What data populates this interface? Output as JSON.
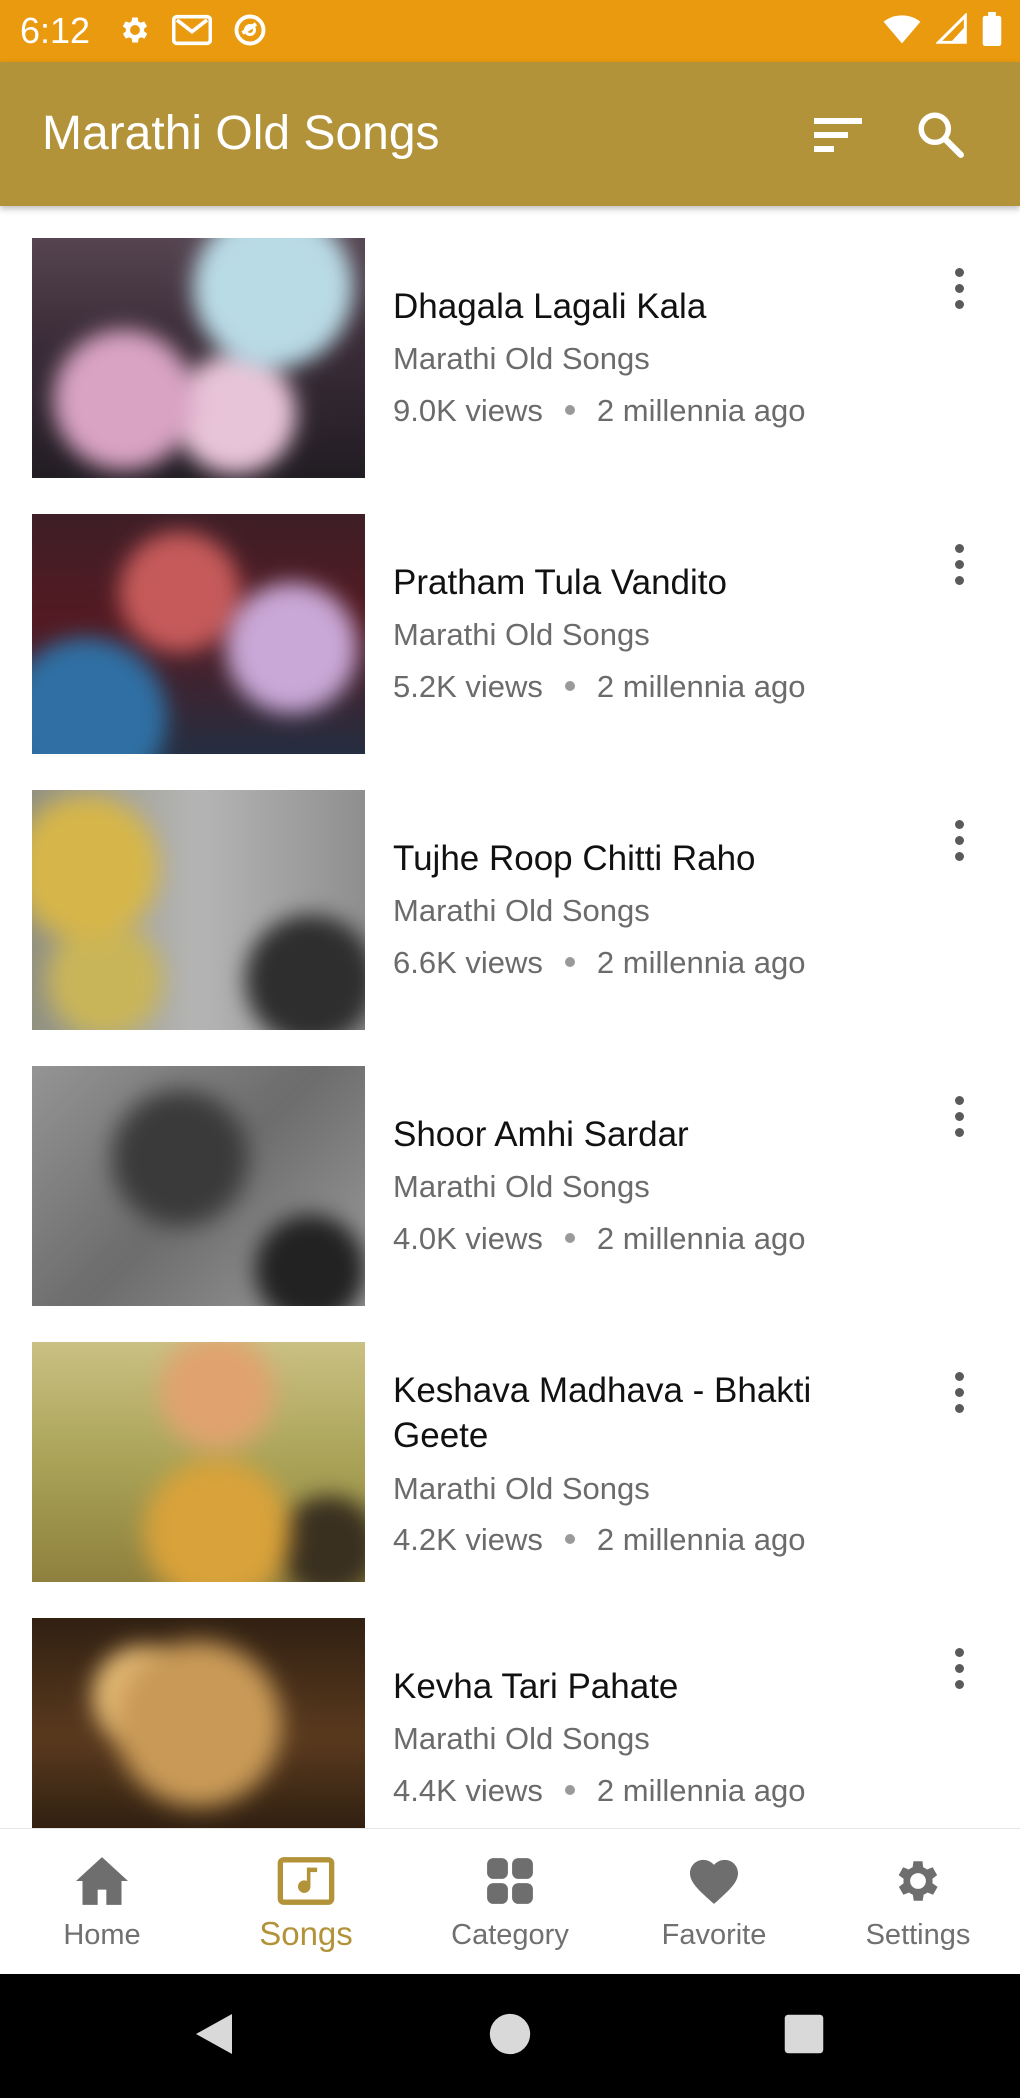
{
  "status_bar": {
    "time": "6:12",
    "left_icons": [
      "settings-icon",
      "gmail-icon",
      "data-saver-icon"
    ],
    "right_icons": [
      "wifi-icon",
      "signal-icon",
      "battery-icon"
    ],
    "background": "#EA9A0E"
  },
  "app_bar": {
    "title": "Marathi Old Songs",
    "actions": [
      "sort-icon",
      "search-icon"
    ],
    "background": "#B3933A"
  },
  "songs": [
    {
      "title": "Dhagala Lagali Kala",
      "channel": "Marathi Old Songs",
      "views": "9.0K views",
      "age": "2 millennia ago"
    },
    {
      "title": "Pratham Tula Vandito",
      "channel": "Marathi Old Songs",
      "views": "5.2K views",
      "age": "2 millennia ago"
    },
    {
      "title": "Tujhe Roop Chitti Raho",
      "channel": "Marathi Old Songs",
      "views": "6.6K views",
      "age": "2 millennia ago"
    },
    {
      "title": "Shoor Amhi Sardar",
      "channel": "Marathi Old Songs",
      "views": "4.0K views",
      "age": "2 millennia ago"
    },
    {
      "title": "Keshava Madhava - Bhakti Geete",
      "channel": "Marathi Old Songs",
      "views": "4.2K views",
      "age": "2 millennia ago"
    },
    {
      "title": "Kevha Tari Pahate",
      "channel": "Marathi Old Songs",
      "views": "4.4K views",
      "age": "2 millennia ago"
    }
  ],
  "bottom_nav": {
    "items": [
      {
        "label": "Home",
        "icon": "home-icon"
      },
      {
        "label": "Songs",
        "icon": "music-note-icon",
        "active": true
      },
      {
        "label": "Category",
        "icon": "category-icon"
      },
      {
        "label": "Favorite",
        "icon": "heart-icon"
      },
      {
        "label": "Settings",
        "icon": "gear-icon"
      }
    ],
    "active_color": "#B3933A"
  },
  "system_nav": [
    "back-icon",
    "home-circle-icon",
    "recents-icon"
  ]
}
